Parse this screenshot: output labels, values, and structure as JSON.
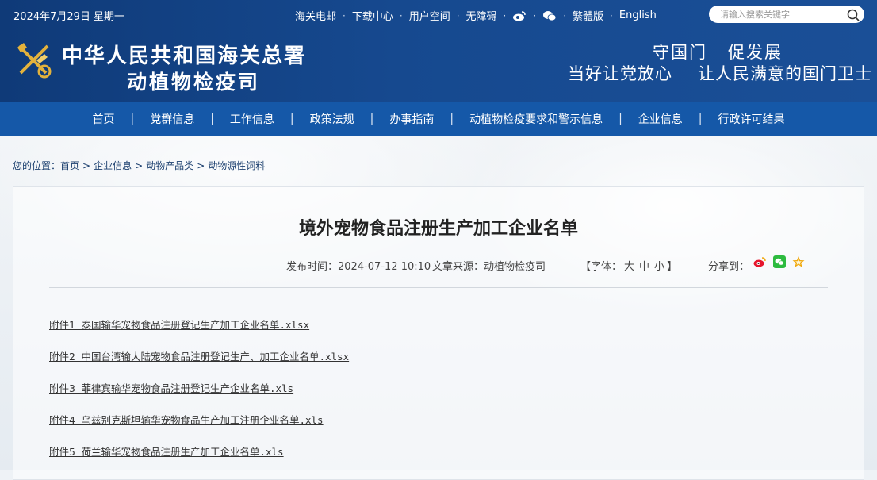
{
  "topbar": {
    "date": "2024年7月29日 星期一",
    "links": {
      "email": "海关电邮",
      "download": "下载中心",
      "user": "用户空间",
      "accessible": "无障碍",
      "traditional": "繁體版",
      "english": "English"
    },
    "search_placeholder": "请输入搜索关键字"
  },
  "header": {
    "title_line1": "中华人民共和国海关总署",
    "title_line2": "动植物检疫司",
    "slogan_a": "守国门",
    "slogan_b": "促发展",
    "slogan_c": "当好让党放心",
    "slogan_d": "让人民满意的国门卫士"
  },
  "nav": [
    "首页",
    "党群信息",
    "工作信息",
    "政策法规",
    "办事指南",
    "动植物检疫要求和警示信息",
    "企业信息",
    "行政许可结果"
  ],
  "breadcrumb": {
    "prefix": "您的位置：",
    "items": [
      "首页",
      "企业信息",
      "动物产品类",
      "动物源性饲料"
    ],
    "sep": ">"
  },
  "article": {
    "title": "境外宠物食品注册生产加工企业名单",
    "publish_label": "发布时间：",
    "publish_time": "2024-07-12 10:10",
    "source_label": "文章来源：",
    "source": "动植物检疫司",
    "font_open": "【字体：",
    "font_large": "大",
    "font_medium": "中",
    "font_small": "小",
    "font_close": "】",
    "share_label": "分享到："
  },
  "attachments": [
    {
      "label": "附件1",
      "name": "泰国输华宠物食品注册登记生产加工企业名单.xlsx"
    },
    {
      "label": "附件2",
      "name": "中国台湾输大陆宠物食品注册登记生产、加工企业名单.xlsx"
    },
    {
      "label": "附件3",
      "name": "菲律宾输华宠物食品注册登记生产企业名单.xls"
    },
    {
      "label": "附件4",
      "name": "乌兹别克斯坦输华宠物食品生产加工注册企业名单.xls"
    },
    {
      "label": "附件5",
      "name": "荷兰输华宠物食品注册生产加工企业名单.xls"
    }
  ],
  "colors": {
    "header_bg": "#16498f",
    "nav_bg": "#1558a8",
    "weibo": "#e6162d",
    "wechat": "#2dbb3f",
    "favorite": "#f0a80c"
  }
}
